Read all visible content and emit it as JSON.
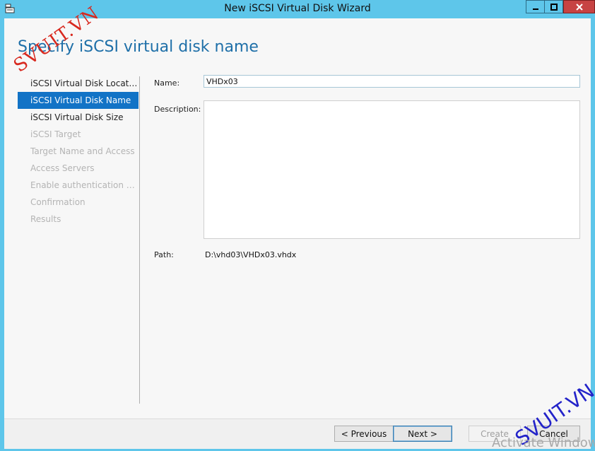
{
  "window": {
    "title": "New iSCSI Virtual Disk Wizard"
  },
  "page": {
    "title": "Specify iSCSI virtual disk name"
  },
  "steps": [
    {
      "label": "iSCSI Virtual Disk Location",
      "state": "done"
    },
    {
      "label": "iSCSI Virtual Disk Name",
      "state": "active"
    },
    {
      "label": "iSCSI Virtual Disk Size",
      "state": "enabled"
    },
    {
      "label": "iSCSI Target",
      "state": "disabled"
    },
    {
      "label": "Target Name and Access",
      "state": "disabled"
    },
    {
      "label": "Access Servers",
      "state": "disabled"
    },
    {
      "label": "Enable authentication ser...",
      "state": "disabled"
    },
    {
      "label": "Confirmation",
      "state": "disabled"
    },
    {
      "label": "Results",
      "state": "disabled"
    }
  ],
  "form": {
    "name_label": "Name:",
    "name_value": "VHDx03",
    "description_label": "Description:",
    "description_value": "",
    "path_label": "Path:",
    "path_value": "D:\\vhd03\\VHDx03.vhdx"
  },
  "buttons": {
    "previous": "< Previous",
    "next": "Next >",
    "create": "Create",
    "cancel": "Cancel"
  },
  "watermarks": {
    "top_left": "SVUIT.VN",
    "bottom_right": "SVUIT.VN",
    "activate": "Activate Window"
  },
  "colors": {
    "titlebar": "#5ec6ea",
    "active_step": "#1273c6",
    "page_title": "#1e6fa8",
    "close_button": "#c74343"
  },
  "icons": {
    "app": "server-manager-icon",
    "minimize": "minimize-icon",
    "maximize": "maximize-icon",
    "close": "close-icon"
  }
}
